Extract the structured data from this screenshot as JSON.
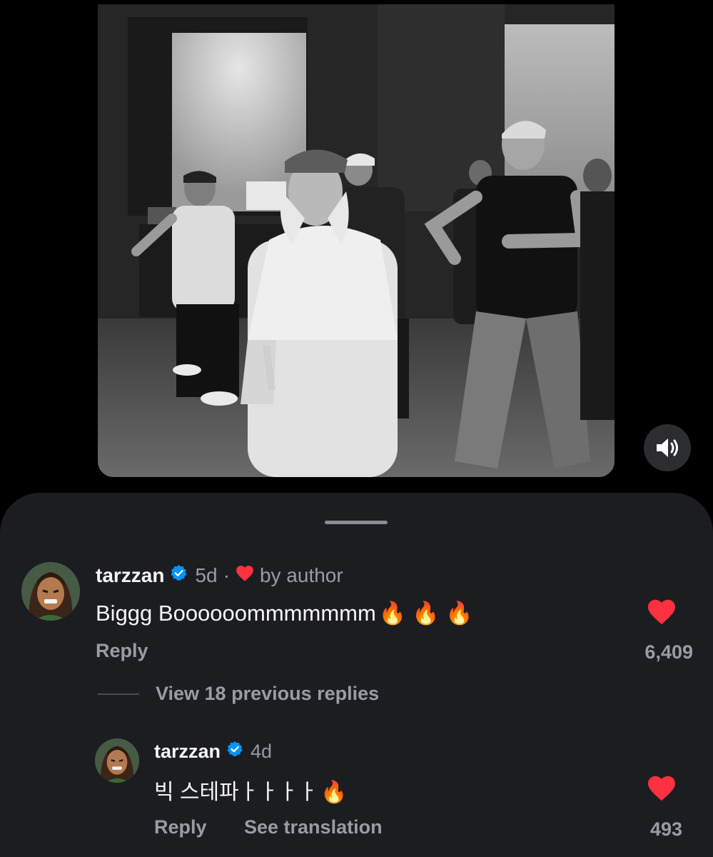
{
  "post": {
    "media_description_icon": "dance-video",
    "mute_icon": "speaker-icon"
  },
  "comments": [
    {
      "username": "tarzzan",
      "verified": true,
      "time": "5d",
      "separator": "·",
      "author_liked": "by author",
      "text": "Biggg Boooooommmmmmm",
      "emojis": "🔥🔥🔥",
      "reply_label": "Reply",
      "likes": "6,409",
      "liked": true
    }
  ],
  "view_replies_label": "View 18 previous replies",
  "replies": [
    {
      "username": "tarzzan",
      "verified": true,
      "time": "4d",
      "text": "빅 스테파ㅏㅏㅏㅏ",
      "emojis": "🔥",
      "reply_label": "Reply",
      "translate_label": "See translation",
      "likes": "493",
      "liked": true
    }
  ],
  "colors": {
    "background": "#000000",
    "sheet": "#1c1d21",
    "heart": "#ff3040",
    "verified": "#0095f6",
    "secondary_text": "#9b9ca2"
  }
}
